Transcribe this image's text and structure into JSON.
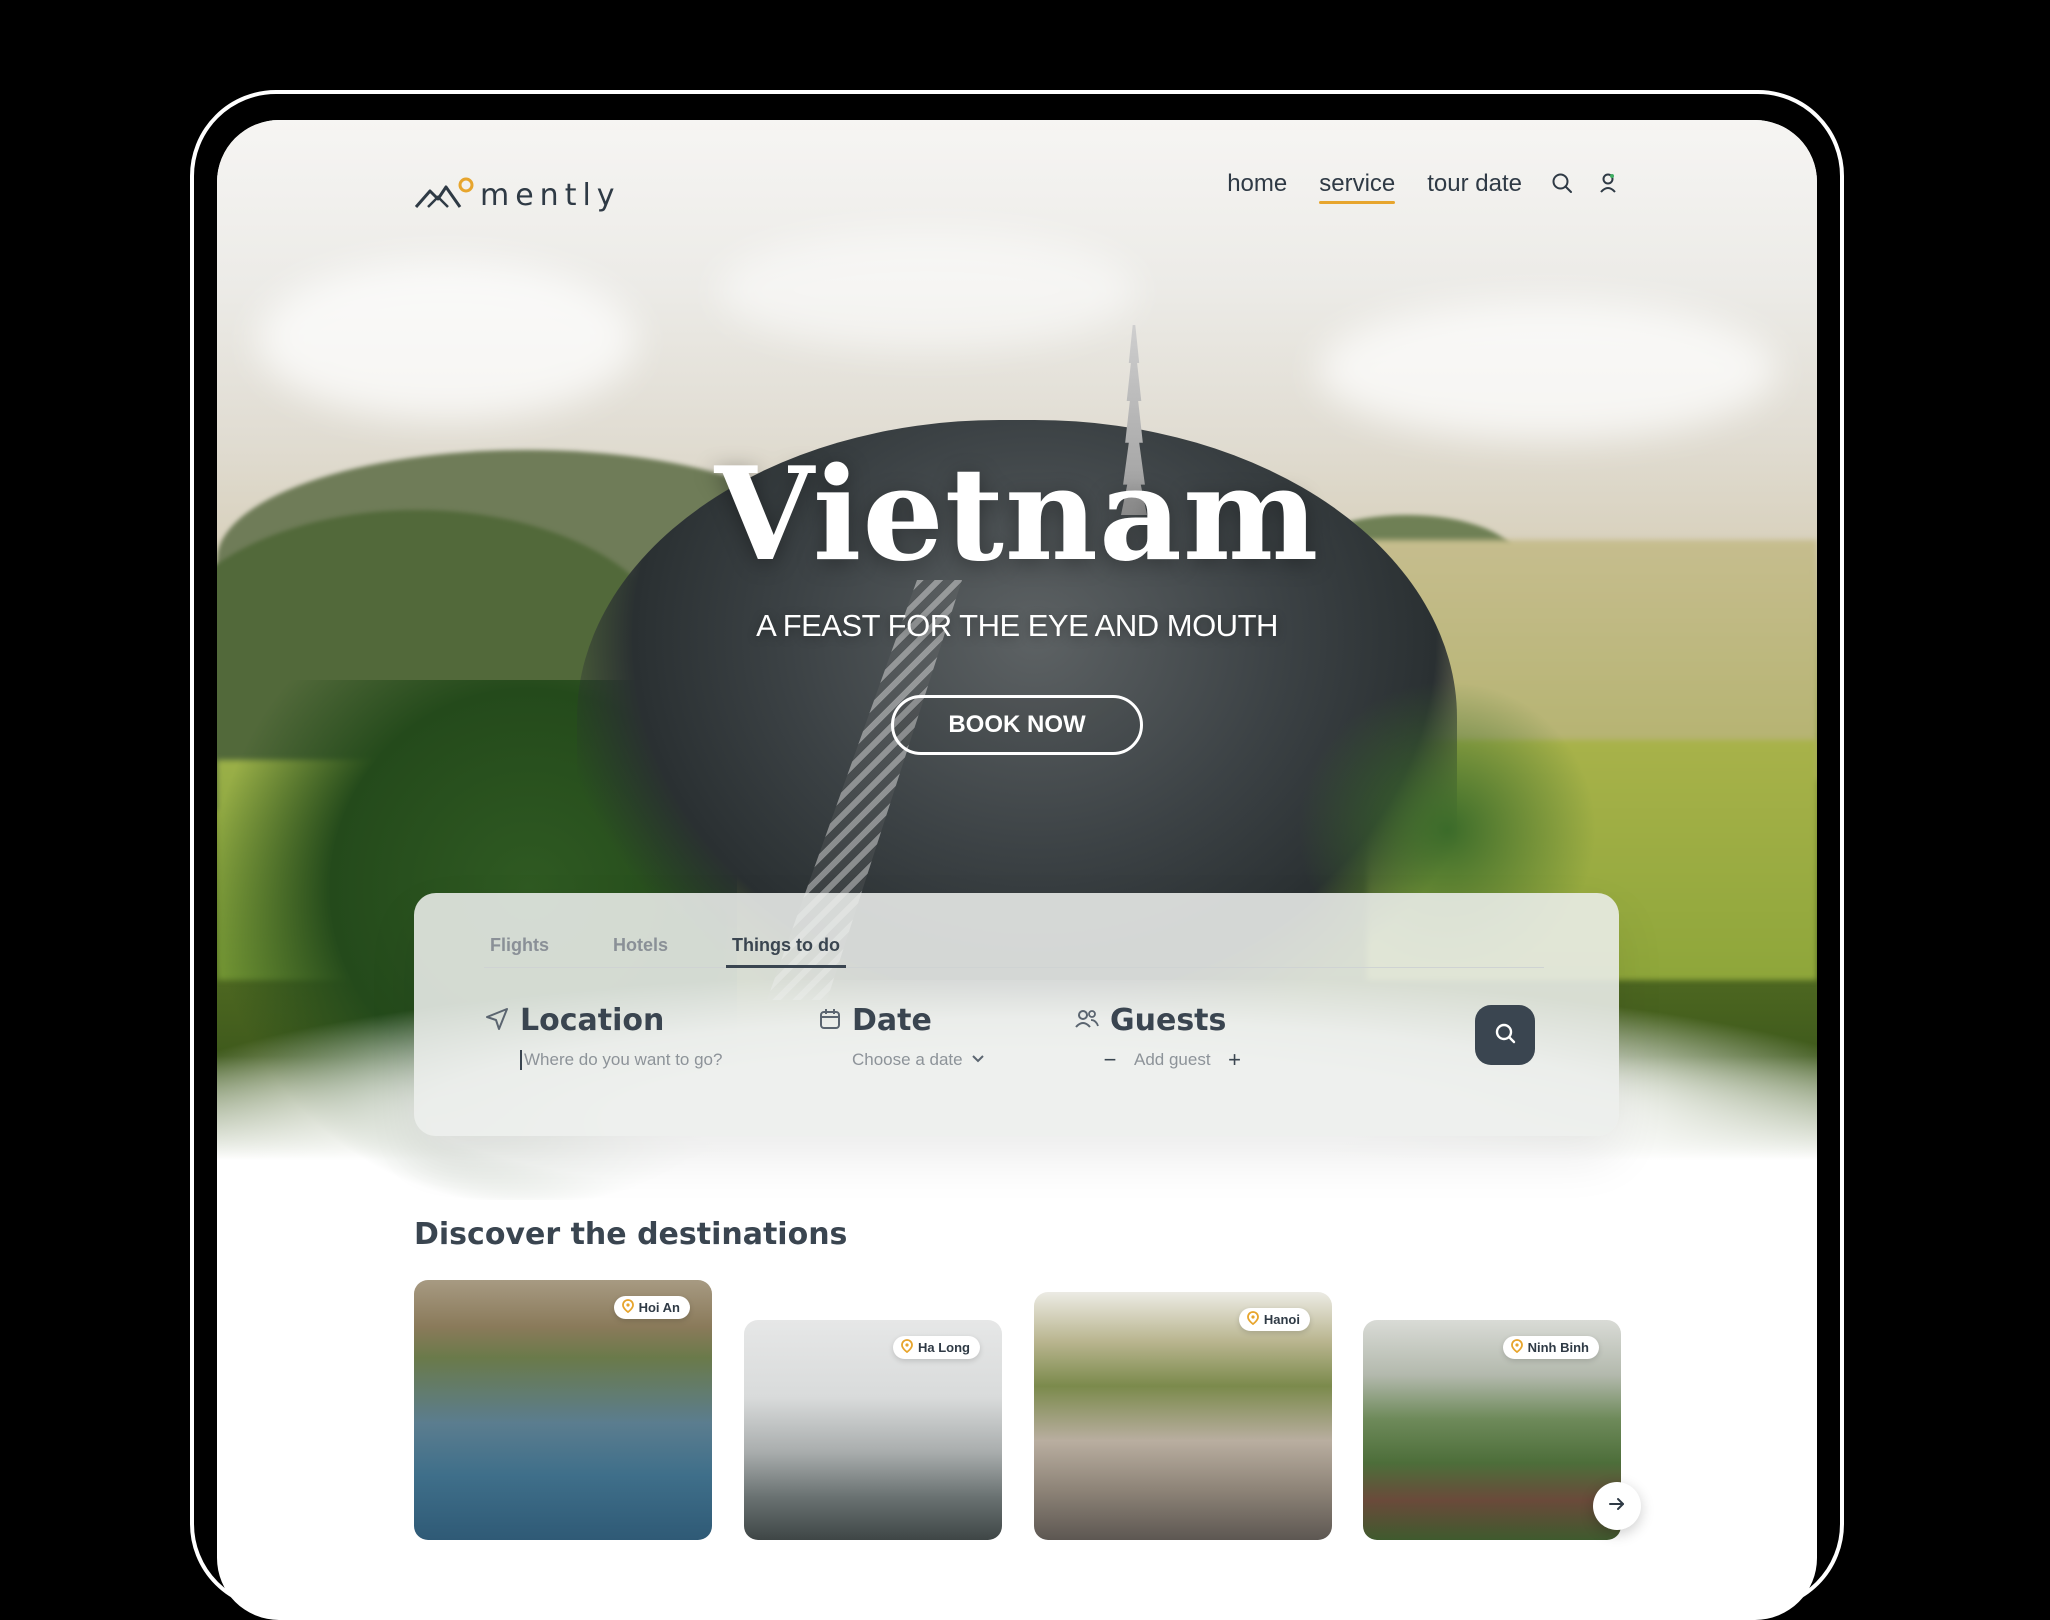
{
  "brand": {
    "name": "mently",
    "accent": "#e7a52d",
    "dark": "#3a4550"
  },
  "nav": {
    "links": [
      "home",
      "service",
      "tour date"
    ],
    "active": "service",
    "icons": [
      "search-icon",
      "user-icon"
    ]
  },
  "hero": {
    "title": "Vietnam",
    "subtitle": "A FEAST FOR THE EYE AND MOUTH",
    "cta_label": "BOOK NOW"
  },
  "search": {
    "tabs": [
      "Flights",
      "Hotels",
      "Things to do"
    ],
    "active_tab": "Things to do",
    "location": {
      "label": "Location",
      "placeholder": "Where do you want to go?",
      "icon": "send-icon"
    },
    "date": {
      "label": "Date",
      "placeholder": "Choose a date",
      "icon": "calendar-icon"
    },
    "guests": {
      "label": "Guests",
      "placeholder": "Add guest",
      "icon": "users-icon",
      "minus": "−",
      "plus": "+"
    },
    "submit_icon": "search-icon"
  },
  "discover": {
    "title": "Discover the destinations",
    "cards": [
      {
        "name": "Hoi An"
      },
      {
        "name": "Ha Long"
      },
      {
        "name": "Hanoi"
      },
      {
        "name": "Ninh Binh"
      }
    ],
    "next_icon": "arrow-right-icon"
  }
}
